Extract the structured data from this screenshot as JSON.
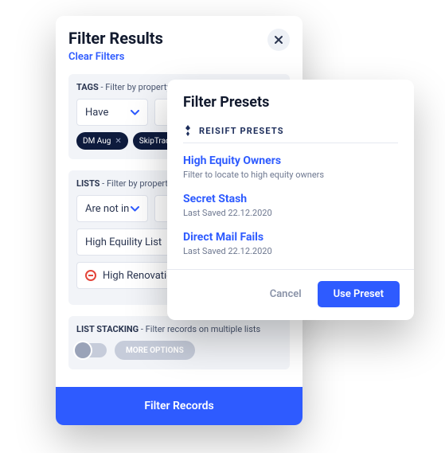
{
  "panel": {
    "title": "Filter Results",
    "clear": "Clear Filters",
    "footer_button": "Filter Records"
  },
  "tags": {
    "heading_label": "TAGS",
    "heading_rest": " - Filter by property tags",
    "dropdown_value": "Have",
    "chips": [
      "DM Aug",
      "SkipTraced"
    ]
  },
  "lists": {
    "heading_label": "LISTS",
    "heading_rest": " - Filter by property lists",
    "dropdown_value": "Are not in",
    "items": [
      {
        "label": "High Equility List",
        "exclude": false
      },
      {
        "label": "High Renovation List",
        "exclude": true
      }
    ]
  },
  "stacking": {
    "heading_label": "LIST STACKING",
    "heading_rest": " - Filter records on multiple lists",
    "button": "MORE OPTIONS"
  },
  "popover": {
    "title": "Filter Presets",
    "subtitle": "REISIFT PRESETS",
    "presets": [
      {
        "title": "High Equity Owners",
        "sub": "Filter to locate to high equity owners"
      },
      {
        "title": "Secret Stash",
        "sub": "Last Saved 22.12.2020"
      },
      {
        "title": "Direct Mail Fails",
        "sub": "Last Saved 22.12.2020"
      }
    ],
    "cancel": "Cancel",
    "use": "Use Preset"
  }
}
